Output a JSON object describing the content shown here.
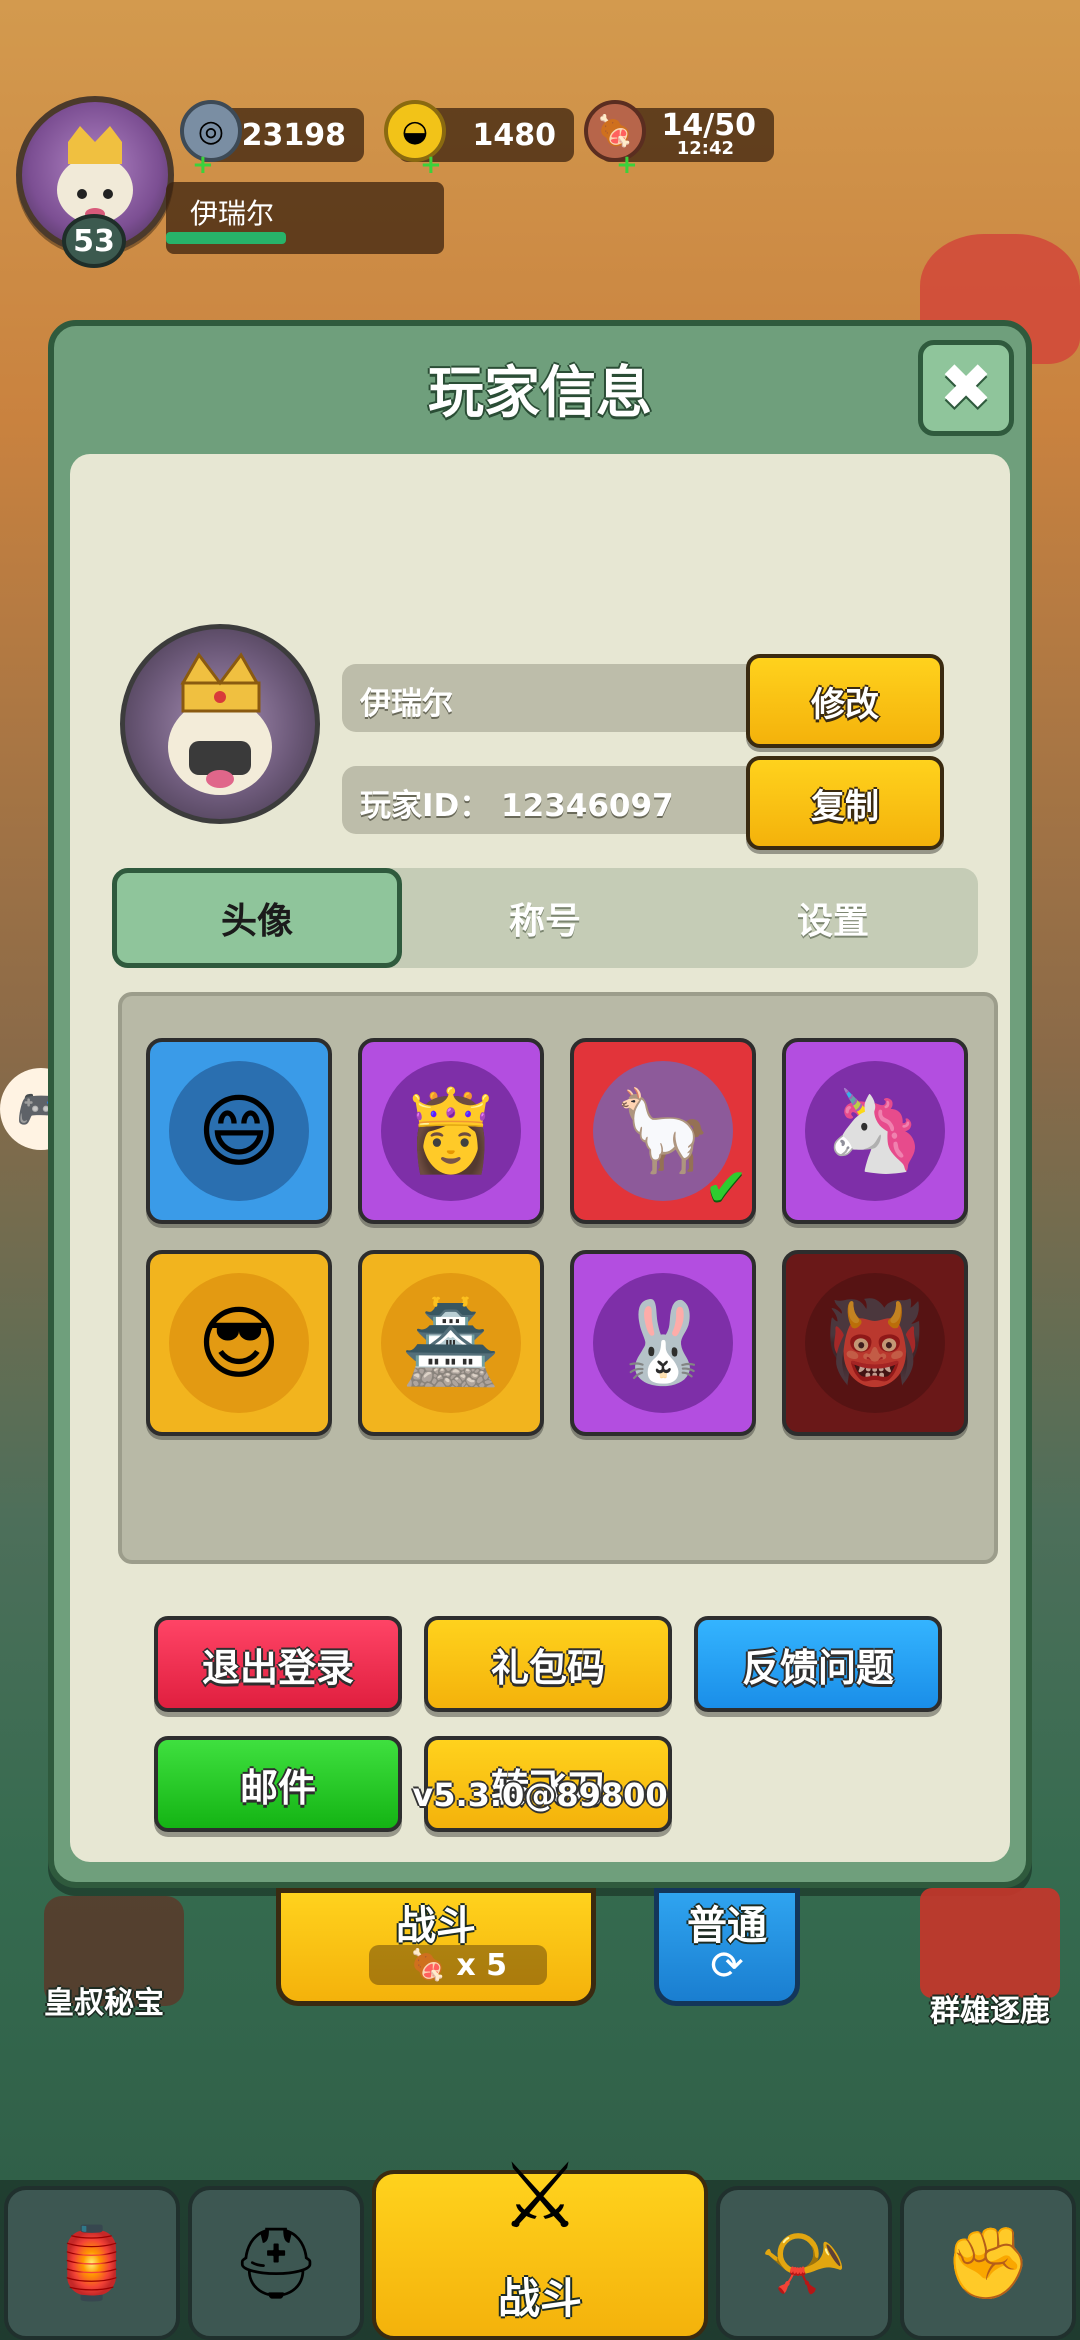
{
  "hud": {
    "level": "53",
    "player_name": "伊瑞尔",
    "coins": "23198",
    "gold": "1480",
    "stamina": "14/50",
    "stamina_timer": "12:42"
  },
  "modal": {
    "title": "玩家信息",
    "close_symbol": "✖",
    "name_value": "伊瑞尔",
    "id_value": "玩家ID：   12346097",
    "edit_label": "修改",
    "copy_label": "复制",
    "tabs": [
      {
        "label": "头像",
        "active": true
      },
      {
        "label": "称号",
        "active": false
      },
      {
        "label": "设置",
        "active": false
      }
    ],
    "avatars": [
      {
        "name": "avatar-warrior-blue",
        "bg": "#3a9be8",
        "selected": false
      },
      {
        "name": "avatar-purple-hair",
        "bg": "#b34ee0",
        "selected": false
      },
      {
        "name": "avatar-crowned-alpaca",
        "bg": "#e2343a",
        "selected": true
      },
      {
        "name": "avatar-unicorn",
        "bg": "#b34ee0",
        "selected": false
      },
      {
        "name": "avatar-sunglasses",
        "bg": "#f2b41e",
        "selected": false
      },
      {
        "name": "avatar-palace",
        "bg": "#f2b41e",
        "selected": false
      },
      {
        "name": "avatar-rabbit",
        "bg": "#b34ee0",
        "selected": false
      },
      {
        "name": "avatar-locked-warrior",
        "bg": "#6a1818",
        "selected": false
      }
    ],
    "buttons": {
      "logout": "退出登录",
      "gift_code": "礼包码",
      "feedback": "反馈问题",
      "mail": "邮件",
      "spin_knife": "转飞刀"
    },
    "version": "v5.3.0@89800"
  },
  "bottom": {
    "treasure_label": "皇叔秘宝",
    "battle_label": "战斗",
    "battle_cost": "x 5",
    "normal_label": "普通",
    "heroes_label": "群雄逐鹿",
    "nav_battle_label": "战斗"
  },
  "colors": {
    "accent_green": "#8fc59b",
    "button_yellow": "#ffd21d",
    "button_red": "#f0284a",
    "button_blue": "#1a9ef0",
    "button_green": "#1fcf1f"
  }
}
